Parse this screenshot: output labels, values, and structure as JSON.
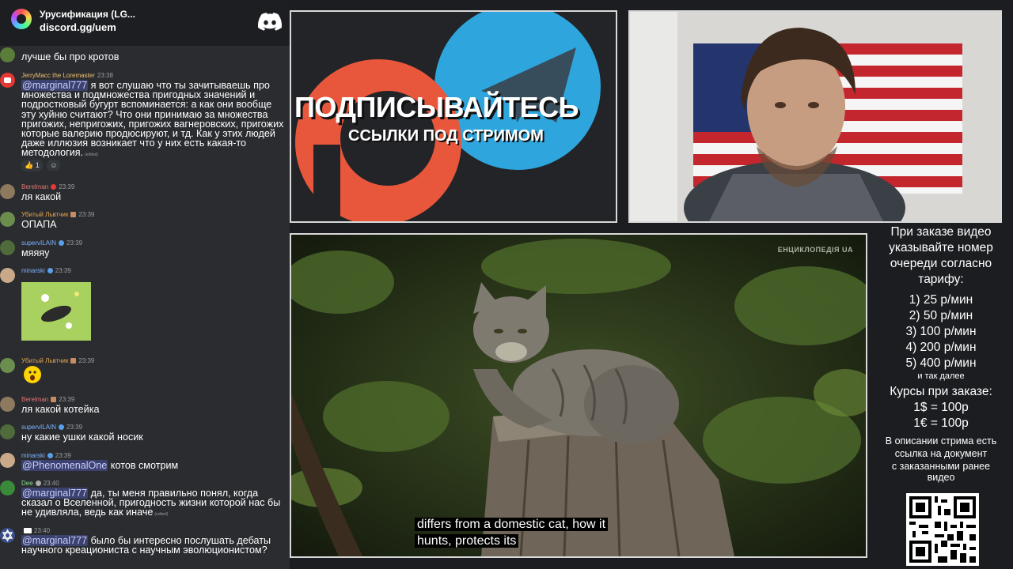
{
  "chat": {
    "server_name": "Урусификация (LG...",
    "server_link": "discord.gg/uem",
    "messages": [
      {
        "text": "лучше бы про кротов"
      },
      {
        "username": "JerryMacc the Loremaster",
        "time": "23:38",
        "mention": "@marginal777",
        "text": " я вот слушаю что ты зачитываешь про множества и подмножества пригодных значений и подростковый бугурт вспоминается: а как они вообще эту хуйню считают? Что они принимаю за множества пригожих, непригожих, пригожих вагнеровских, пригожих которые валерию продюсируют, и тд. Как у этих людей даже иллюзия возникает что у них есть какая-то методология.",
        "edited": "(edited)",
        "reaction_count": "1"
      },
      {
        "username": "Berelman",
        "time": "23:39",
        "text": "ля какой"
      },
      {
        "username": "Убитый Львтчик",
        "time": "23:39",
        "text": "ОПАПА"
      },
      {
        "username": "supervILAIN",
        "time": "23:39",
        "text": "мяяяу"
      },
      {
        "username": "minarski",
        "time": "23:39"
      },
      {
        "username": "Убитый Львтчик",
        "time": "23:39"
      },
      {
        "username": "Berelman",
        "time": "23:39",
        "text": "ля какой котейка"
      },
      {
        "username": "supervILAIN",
        "time": "23:39",
        "text": "ну какие ушки какой носик"
      },
      {
        "username": "minarski",
        "time": "23:39",
        "mention": "@PhenomenalOne",
        "text": " котов смотрим"
      },
      {
        "username": "Dee",
        "time": "23:40",
        "mention": "@marginal777",
        "text": " да, ты меня правильно понял, когда сказал о Вселенной, пригодность жизни которой нас бы не удивляла, ведь как иначе",
        "edited": "(edited)"
      },
      {
        "username": "",
        "time": "23:40",
        "mention": "@marginal777",
        "text": " было бы интересно послушать дебаты научного креациониста с научным эволюционистом?"
      }
    ]
  },
  "promo": {
    "title": "ПОДПИСЫВАЙТЕСЬ",
    "subtitle": "ССЫЛКИ ПОД СТРИМОМ",
    "colors": {
      "patreon": "#e8573c",
      "telegram": "#2ea6dd"
    }
  },
  "video": {
    "watermark": "ЕНЦИКЛОПЕДІЯ UA",
    "subtitle_line1": "differs from a domestic cat, how it",
    "subtitle_line2": "hunts, protects its"
  },
  "info": {
    "order_note_1": "При заказе видео",
    "order_note_2": "указывайте номер",
    "order_note_3": "очереди согласно",
    "order_note_4": "тарифу:",
    "tariffs": [
      "1) 25 р/мин",
      "2) 50 р/мин",
      "3) 100 р/мин",
      "4) 200 р/мин",
      "5) 400 р/мин"
    ],
    "and_more": "и так далее",
    "rates_title": "Курсы при заказе:",
    "rate_usd": "1$ = 100р",
    "rate_eur": "1€ = 100р",
    "desc_1": "В описании стрима есть",
    "desc_2": "ссылка на документ",
    "desc_3": "с заказанными ранее",
    "desc_4": "видео"
  }
}
